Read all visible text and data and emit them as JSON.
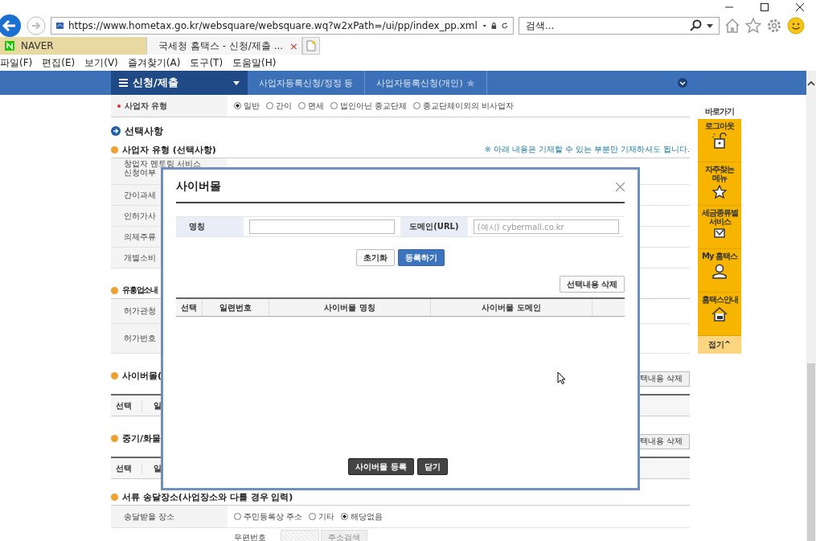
{
  "address_bar": {
    "url": "https://www.hometax.go.kr/websquare/websquare.wq?w2xPath=/ui/pp/index_pp.xml"
  },
  "search": {
    "placeholder": "검색..."
  },
  "tabs": [
    {
      "label": "NAVER",
      "selected": false
    },
    {
      "label": "국세청 홈택스 - 신청/제출 ...",
      "selected": true,
      "close": "×"
    }
  ],
  "menu": [
    "파일(F)",
    "편집(E)",
    "보기(V)",
    "즐겨찾기(A)",
    "도구(T)",
    "도움말(H)"
  ],
  "nav": {
    "menu_label": "신청/제출",
    "breadcrumbs": [
      "사업자등록신청/정정 등",
      "사업자등록신청(개인)"
    ]
  },
  "page": {
    "business_type": {
      "label": "사업자 유형",
      "options": [
        {
          "label": "일반",
          "selected": true
        },
        {
          "label": "간이",
          "selected": false
        },
        {
          "label": "면세",
          "selected": false
        },
        {
          "label": "법인아닌 종교단체",
          "selected": false
        },
        {
          "label": "종교단체이외의 비사업자",
          "selected": false
        }
      ]
    },
    "optional_title": "선택사항",
    "optional_subtitle": "사업자 유형 (선택사항)",
    "note": "※ 아래 내용은 기재할 수 있는 부분만 기재하셔도 됩니다.",
    "optional_rows": [
      [
        "창업자 멘토링 서비스",
        "신청여부"
      ],
      [
        "간이과세"
      ],
      [
        "인허가사"
      ],
      [
        "의제주류"
      ],
      [
        "개별소비"
      ]
    ],
    "entertainment": {
      "title": "유흥업소내",
      "rows": [
        "허가관청",
        "허가번호"
      ]
    },
    "cybermall": {
      "title": "사이버몰(",
      "delete_button": "택내용 삭제",
      "columns": [
        "선택",
        "일"
      ]
    },
    "vehicle": {
      "title": "중기/화물",
      "delete_button": "택내용 삭제",
      "columns": [
        "선택",
        "일"
      ]
    },
    "delivery": {
      "title": "서류 송달장소(사업장소와 다를 경우 입력)",
      "place_label": "송달받을 장소",
      "options": [
        {
          "label": "주민등록상 주소",
          "selected": false
        },
        {
          "label": "기타",
          "selected": false
        },
        {
          "label": "해당없음",
          "selected": true
        }
      ],
      "postcode_label": "우편번호",
      "address_search": "주소검색"
    }
  },
  "quick_menu": {
    "title": "바로가기",
    "items": [
      {
        "label": "로그아웃",
        "kind": "lock"
      },
      {
        "label": "자주찾는 메뉴",
        "kind": "star"
      },
      {
        "label": "세금종류별 서비스",
        "kind": "check"
      },
      {
        "label": "My 홈택스",
        "kind": "person"
      },
      {
        "label": "홈택스안내",
        "kind": "house"
      }
    ],
    "collapse": "접기^"
  },
  "dialog": {
    "title": "사이버몰",
    "name_label": "명칭",
    "domain_label": "도메인(URL)",
    "domain_placeholder": "(예시) cybermall.co.kr",
    "reset_button": "초기화",
    "register_button": "등록하기",
    "delete_button": "선택내용 삭제",
    "columns": [
      "선택",
      "일련번호",
      "사이버몰 명칭",
      "사이버몰 도메인"
    ],
    "submit_button": "사이버몰 등록",
    "close_button": "닫기"
  }
}
